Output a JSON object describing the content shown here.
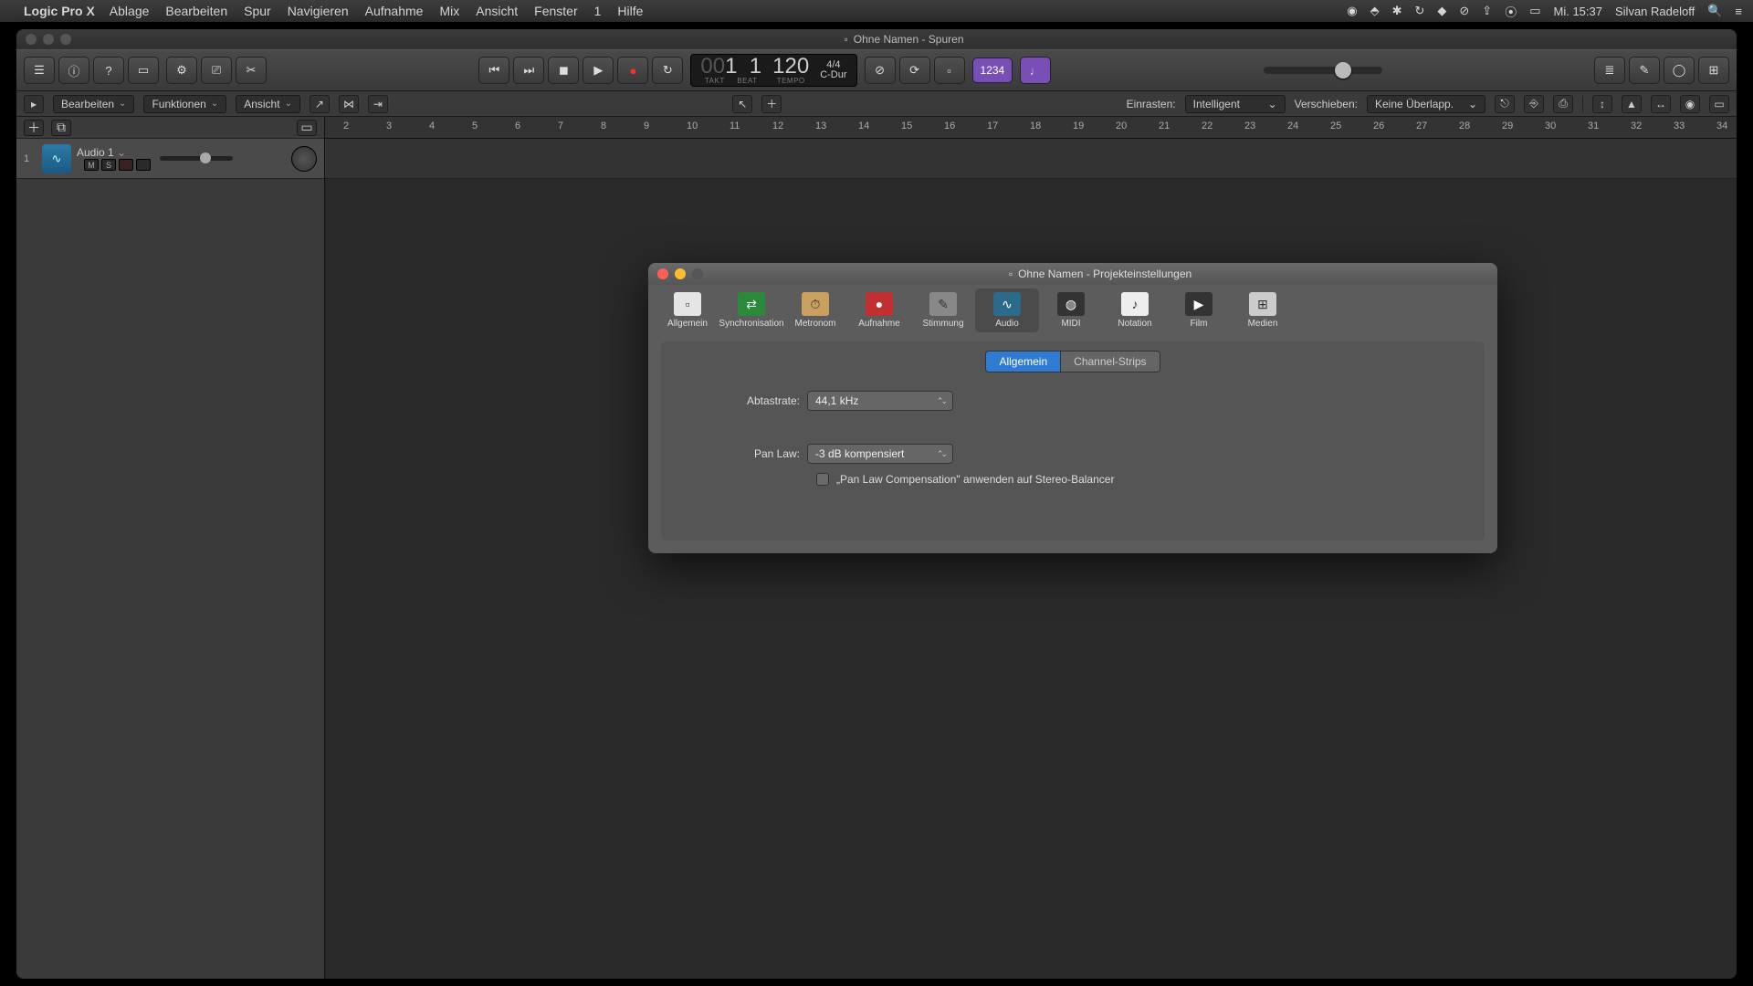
{
  "menubar": {
    "app": "Logic Pro X",
    "items": [
      "Ablage",
      "Bearbeiten",
      "Spur",
      "Navigieren",
      "Aufnahme",
      "Mix",
      "Ansicht",
      "Fenster",
      "1",
      "Hilfe"
    ],
    "clock": "Mi. 15:37",
    "user": "Silvan Radeloff"
  },
  "window": {
    "title": "Ohne Namen - Spuren"
  },
  "transport": {
    "bars_dim": "00",
    "bars": "1",
    "beat": "1",
    "beat_sub": "BEAT",
    "takt_sub": "TAKT",
    "tempo": "120",
    "tempo_sub": "TEMPO",
    "timesig": "4/4",
    "key": "C-Dur",
    "badge": "1234"
  },
  "toolrow": {
    "edit": "Bearbeiten",
    "func": "Funktionen",
    "view": "Ansicht",
    "snap_label": "Einrasten:",
    "snap_value": "Intelligent",
    "move_label": "Verschieben:",
    "move_value": "Keine Überlapp."
  },
  "track": {
    "num": "1",
    "name": "Audio 1",
    "m": "M",
    "s": "S"
  },
  "ruler_marks": [
    2,
    3,
    4,
    5,
    6,
    7,
    8,
    9,
    10,
    11,
    12,
    13,
    14,
    15,
    16,
    17,
    18,
    19,
    20,
    21,
    22,
    23,
    24,
    25,
    26,
    27,
    28,
    29,
    30,
    31,
    32,
    33,
    34
  ],
  "settings": {
    "title": "Ohne Namen - Projekteinstellungen",
    "tabs": [
      "Allgemein",
      "Synchronisation",
      "Metronom",
      "Aufnahme",
      "Stimmung",
      "Audio",
      "MIDI",
      "Notation",
      "Film",
      "Medien"
    ],
    "selected_tab": "Audio",
    "seg1": "Allgemein",
    "seg2": "Channel-Strips",
    "sample_label": "Abtastrate:",
    "sample_value": "44,1 kHz",
    "pan_label": "Pan Law:",
    "pan_value": "-3 dB kompensiert",
    "pan_check": "„Pan Law Compensation\" anwenden auf Stereo-Balancer"
  }
}
